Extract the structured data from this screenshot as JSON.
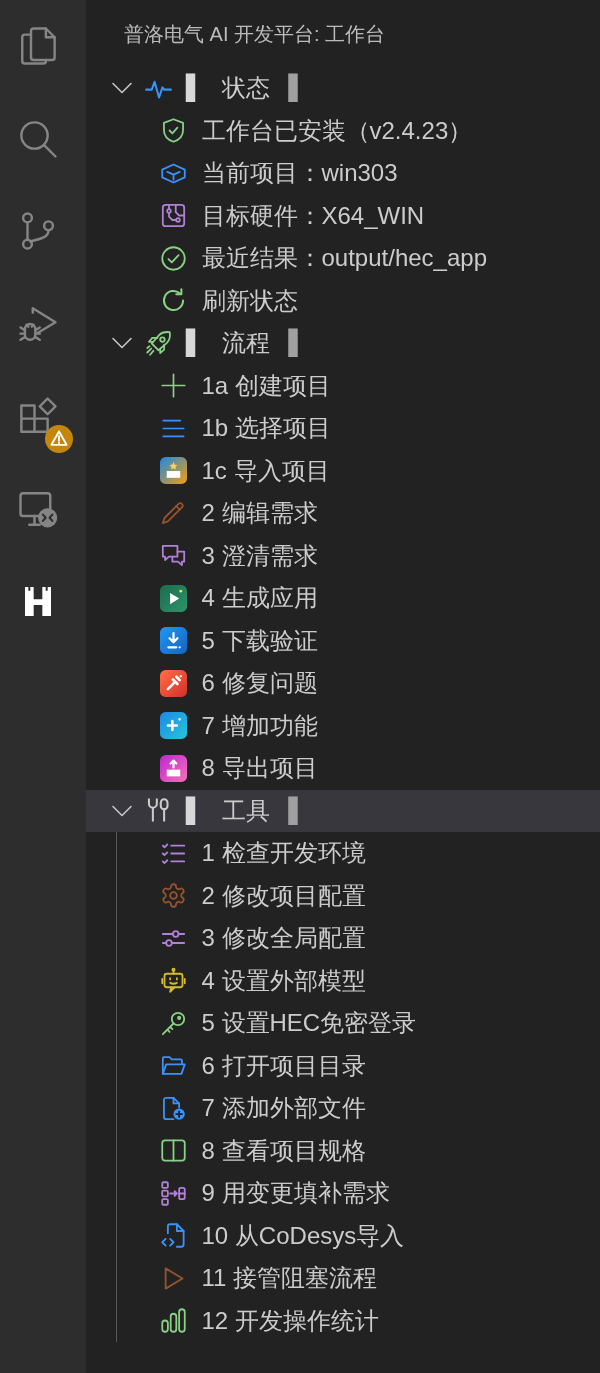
{
  "activity_bar": {
    "items": [
      {
        "selected": false,
        "warning": false
      },
      {
        "selected": false,
        "warning": false
      },
      {
        "selected": false,
        "warning": false
      },
      {
        "selected": false,
        "warning": false
      },
      {
        "selected": false,
        "warning": true
      },
      {
        "selected": false,
        "warning": false
      },
      {
        "selected": true,
        "warning": false
      }
    ]
  },
  "sidebar": {
    "title": "普洛电气 AI 开发平台: 工作台",
    "sections": [
      {
        "label": "状态",
        "marker": "▌",
        "description": "▌",
        "expanded": true,
        "selected": false,
        "items": [
          {
            "label": "工作台已安装（v2.4.23）"
          },
          {
            "label": "当前项目：win303"
          },
          {
            "label": "目标硬件：X64_WIN"
          },
          {
            "label": "最近结果：output/hec_app"
          },
          {
            "label": "刷新状态"
          }
        ]
      },
      {
        "label": "流程",
        "marker": "▌",
        "description": "▌",
        "expanded": true,
        "selected": false,
        "items": [
          {
            "label": "1a 创建项目"
          },
          {
            "label": "1b 选择项目"
          },
          {
            "label": "1c 导入项目"
          },
          {
            "label": "2 编辑需求"
          },
          {
            "label": "3 澄清需求"
          },
          {
            "label": "4 生成应用"
          },
          {
            "label": "5 下载验证"
          },
          {
            "label": "6 修复问题"
          },
          {
            "label": "7 增加功能"
          },
          {
            "label": "8 导出项目"
          }
        ]
      },
      {
        "label": "工具",
        "marker": "▌",
        "description": "▌",
        "expanded": true,
        "selected": true,
        "items": [
          {
            "label": "1 检查开发环境"
          },
          {
            "label": "2 修改项目配置"
          },
          {
            "label": "3 修改全局配置"
          },
          {
            "label": "4 设置外部模型"
          },
          {
            "label": "5 设置HEC免密登录"
          },
          {
            "label": "6 打开项目目录"
          },
          {
            "label": "7 添加外部文件"
          },
          {
            "label": "8 查看项目规格"
          },
          {
            "label": "9 用变更填补需求"
          },
          {
            "label": "10 从CoDesys导入"
          },
          {
            "label": "11 接管阻塞流程"
          },
          {
            "label": "12 开发操作统计"
          }
        ]
      }
    ]
  }
}
